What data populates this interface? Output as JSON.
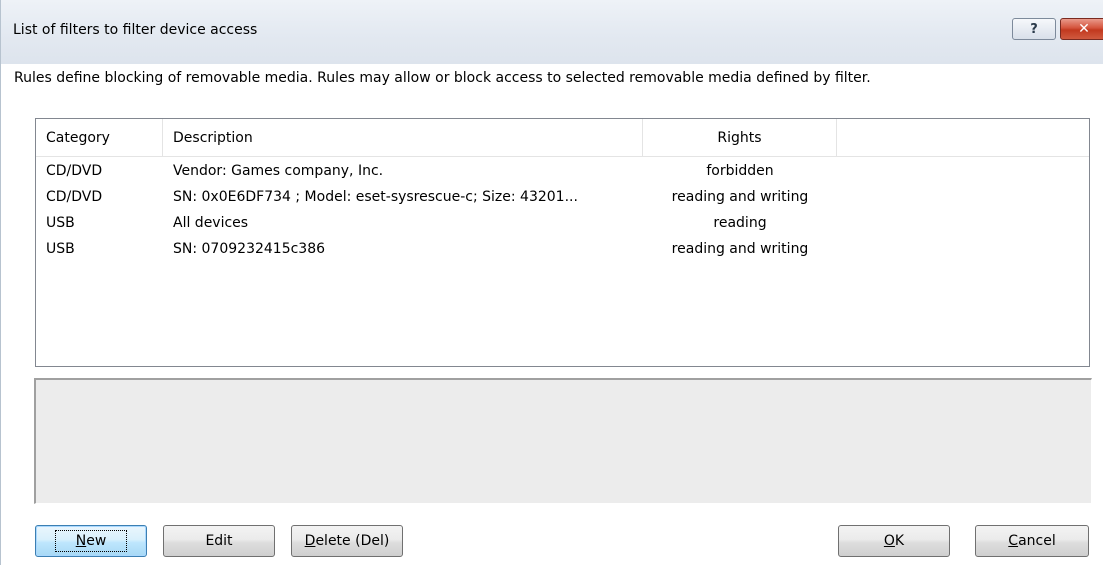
{
  "window": {
    "title": "List of filters to filter device access",
    "help_glyph": "?",
    "close_glyph": "✕"
  },
  "intro": "Rules define blocking of removable media. Rules may allow or block access to selected removable media defined by filter.",
  "list": {
    "columns": [
      "Category",
      "Description",
      "Rights"
    ],
    "rows": [
      {
        "category": "CD/DVD",
        "description": "Vendor: Games company, Inc.",
        "rights": "forbidden"
      },
      {
        "category": "CD/DVD",
        "description": "SN: 0x0E6DF734 ; Model: eset-sysrescue-c; Size: 43201...",
        "rights": "reading and writing"
      },
      {
        "category": "USB",
        "description": "All devices",
        "rights": "reading"
      },
      {
        "category": "USB",
        "description": "SN: 0709232415c386",
        "rights": "reading and writing"
      }
    ]
  },
  "buttons": {
    "new": {
      "accel": "N",
      "rest": "ew"
    },
    "edit": "Edit",
    "delete": {
      "accel": "D",
      "rest": "elete (Del)"
    },
    "ok": {
      "accel": "O",
      "rest": "K"
    },
    "cancel": {
      "accel": "C",
      "rest": "ancel"
    }
  },
  "colors": {
    "titlebar": "#e3e9f1",
    "close_button": "#c2391f",
    "default_button_border": "#3c7fb1",
    "details_panel": "#ececec"
  },
  "icons": [
    "help-icon",
    "close-icon"
  ]
}
